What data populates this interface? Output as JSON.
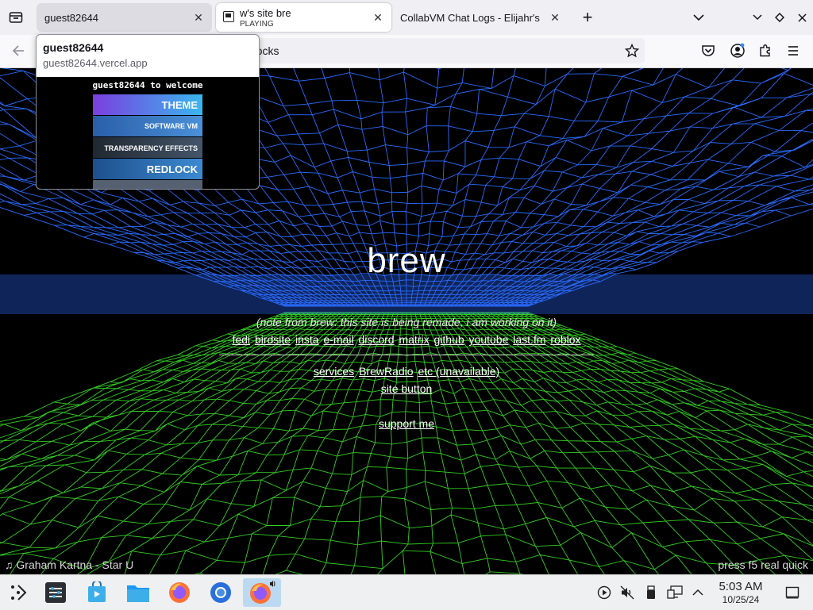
{
  "browser": {
    "tabs": [
      {
        "title": "guest82644"
      },
      {
        "title": "w's site bre",
        "subtitle": "PLAYING"
      },
      {
        "title": "CollabVM Chat Logs - Elijahr's"
      }
    ],
    "url_text": "rocks"
  },
  "preview": {
    "title": "guest82644",
    "url": "guest82644.vercel.app",
    "thumb_heading": "guest82644 to welcome",
    "banners": [
      "THEME",
      "SOFTWARE VM",
      "TRANSPARENCY EFFECTS",
      "REDLOCK"
    ]
  },
  "page": {
    "title": "brew",
    "note": "(note from brew: this site is being remade, i am working on it)",
    "social_links": [
      "fedi",
      "birdsite",
      "insta",
      "e-mail",
      "discord",
      "matrix",
      "github",
      "youtube",
      "last.fm",
      "roblox"
    ],
    "service_links": [
      "services",
      "BrewRadio",
      "etc (unavailable)"
    ],
    "site_button": "site button",
    "support": "support me",
    "now_playing": "Graham Kartna - Star U",
    "hint": "press f5 real quick",
    "colors": {
      "mesh_top": "#2a6bff",
      "mesh_bottom": "#33cc22"
    }
  },
  "taskbar": {
    "time": "5:03 AM",
    "date": "10/25/24"
  }
}
